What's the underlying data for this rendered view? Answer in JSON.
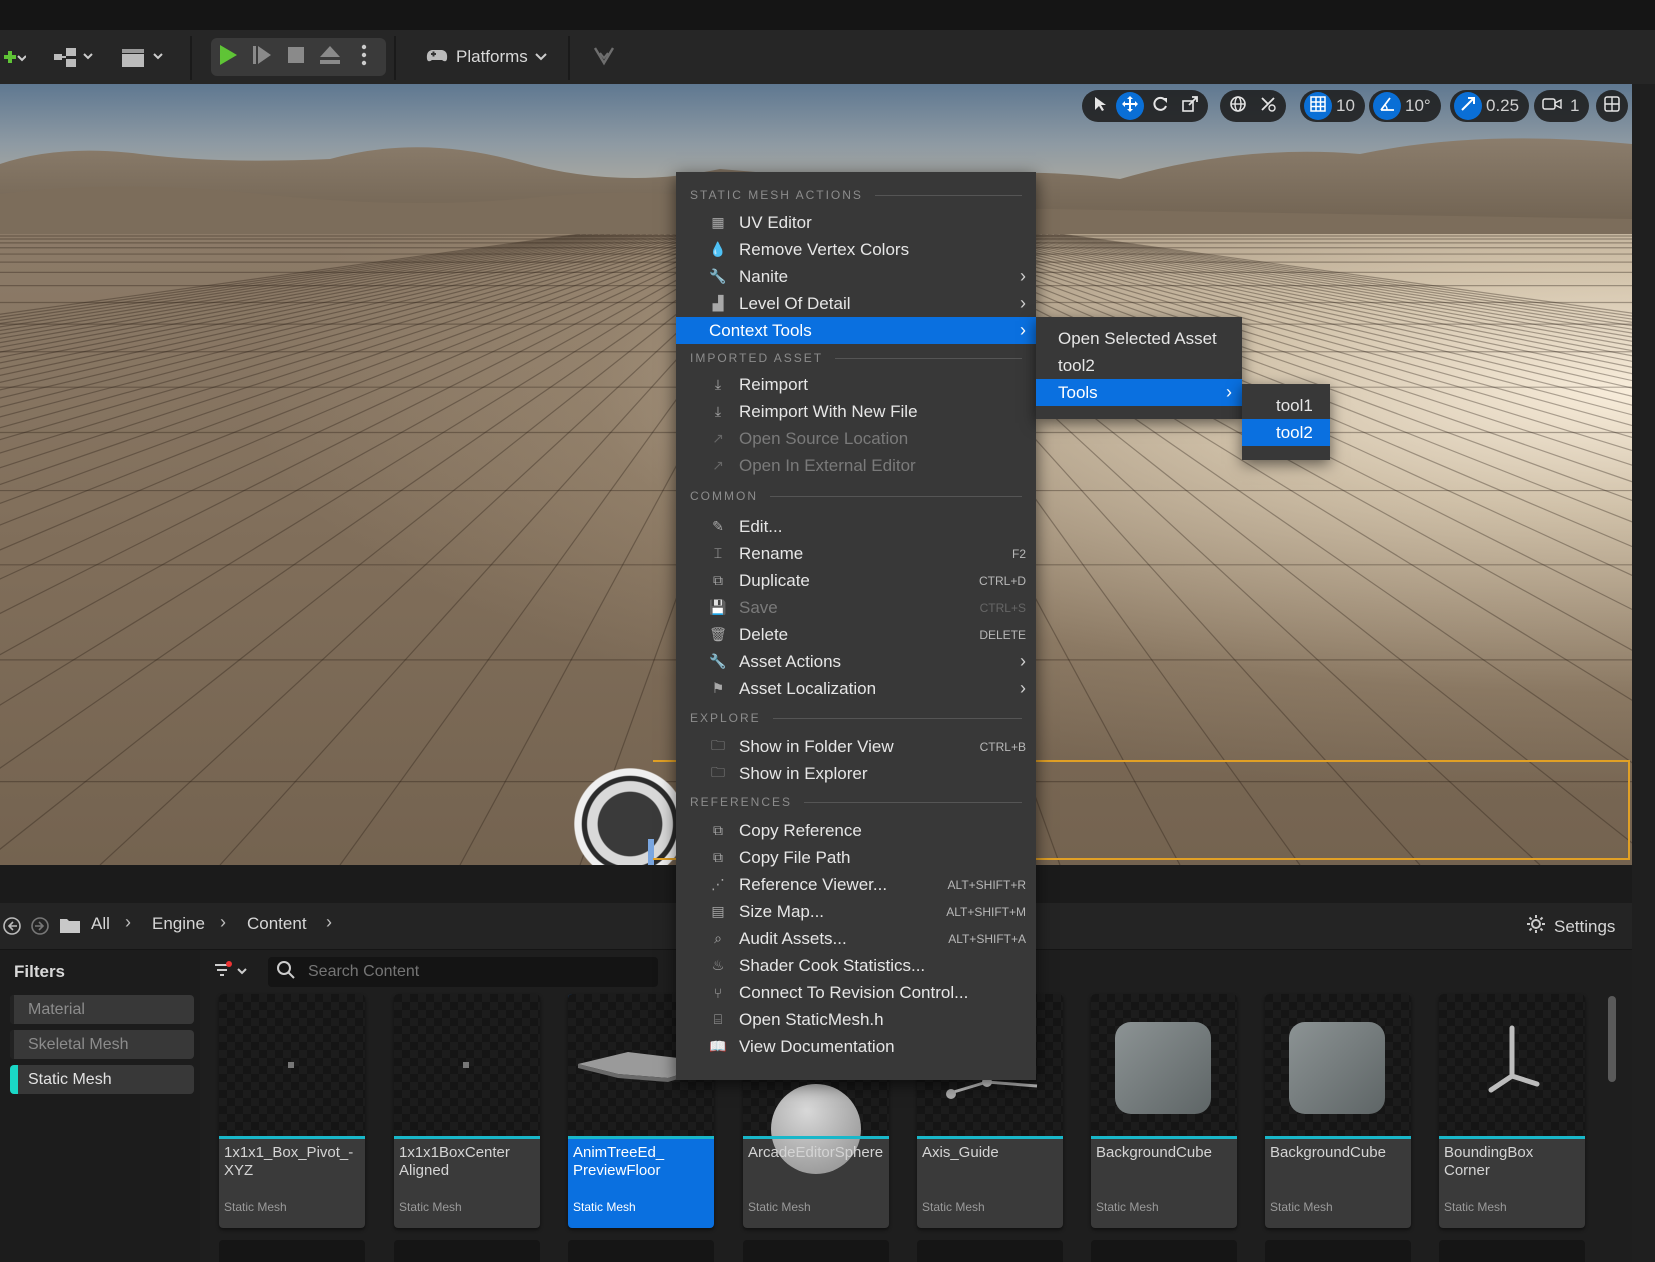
{
  "toolbar": {
    "platforms_label": "Platforms"
  },
  "viewport_toolbar": {
    "grid_snap_value": "10",
    "rotation_snap_value": "10°",
    "scale_snap_value": "0.25",
    "camera_speed_value": "1"
  },
  "context_menu": {
    "sections": {
      "static_mesh_actions": "STATIC MESH ACTIONS",
      "imported_asset": "IMPORTED ASSET",
      "common": "COMMON",
      "explore": "EXPLORE",
      "references": "REFERENCES"
    },
    "items": {
      "uv_editor": "UV Editor",
      "remove_vertex_colors": "Remove Vertex Colors",
      "nanite": "Nanite",
      "level_of_detail": "Level Of Detail",
      "context_tools": "Context Tools",
      "reimport": "Reimport",
      "reimport_new_file": "Reimport With New File",
      "open_source_location": "Open Source Location",
      "open_in_external_editor": "Open In External Editor",
      "edit": "Edit...",
      "rename": "Rename",
      "duplicate": "Duplicate",
      "save": "Save",
      "delete": "Delete",
      "asset_actions": "Asset Actions",
      "asset_localization": "Asset Localization",
      "show_in_folder_view": "Show in Folder View",
      "show_in_explorer": "Show in Explorer",
      "copy_reference": "Copy Reference",
      "copy_file_path": "Copy File Path",
      "reference_viewer": "Reference Viewer...",
      "size_map": "Size Map...",
      "audit_assets": "Audit Assets...",
      "shader_cook_statistics": "Shader Cook Statistics...",
      "connect_to_revision_control": "Connect To Revision Control...",
      "open_staticmesh_h": "Open StaticMesh.h",
      "view_documentation": "View Documentation"
    },
    "shortcuts": {
      "rename": "F2",
      "duplicate": "CTRL+D",
      "save": "CTRL+S",
      "delete": "DELETE",
      "show_in_folder_view": "CTRL+B",
      "reference_viewer": "ALT+SHIFT+R",
      "size_map": "ALT+SHIFT+M",
      "audit_assets": "ALT+SHIFT+A"
    }
  },
  "context_tools_submenu": {
    "open_selected_asset": "Open Selected Asset",
    "tool2": "tool2",
    "tools": "Tools"
  },
  "tools_submenu": {
    "tool1": "tool1",
    "tool2": "tool2"
  },
  "content_browser": {
    "breadcrumbs": [
      "All",
      "Engine",
      "Content"
    ],
    "settings_label": "Settings",
    "filters_title": "Filters",
    "filters": [
      "Material",
      "Skeletal Mesh",
      "Static Mesh"
    ],
    "search_placeholder": "Search Content",
    "assets": [
      {
        "name": "1x1x1_Box_Pivot_-XYZ",
        "type": "Static Mesh"
      },
      {
        "name": "1x1x1BoxCenter Aligned",
        "type": "Static Mesh"
      },
      {
        "name": "AnimTreeEd_ PreviewFloor",
        "type": "Static Mesh"
      },
      {
        "name": "ArcadeEditorSphere",
        "type": "Static Mesh"
      },
      {
        "name": "Axis_Guide",
        "type": "Static Mesh"
      },
      {
        "name": "BackgroundCube",
        "type": "Static Mesh"
      },
      {
        "name": "BackgroundCube",
        "type": "Static Mesh"
      },
      {
        "name": "BoundingBox Corner",
        "type": "Static Mesh"
      }
    ]
  },
  "colors": {
    "accent": "#0a70e0",
    "selection_outline": "#e1a025",
    "asset_bar": "#19b7c9",
    "filter_active": "#1ad7c6",
    "play_green": "#5fc436"
  }
}
